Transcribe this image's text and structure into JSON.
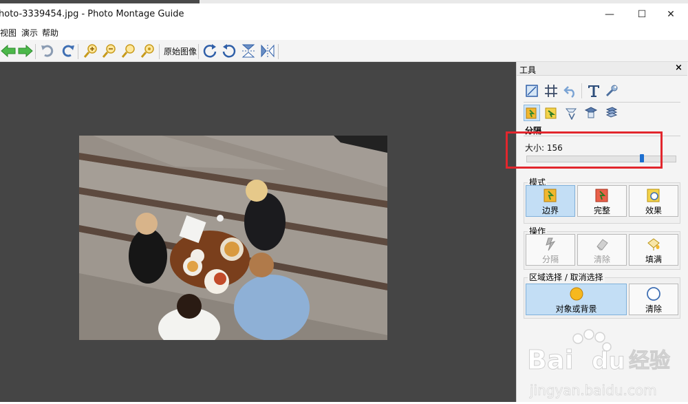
{
  "window": {
    "title": "hoto-3339454.jpg - Photo Montage Guide",
    "controls": {
      "minimize": "—",
      "maximize": "☐",
      "close": "✕"
    }
  },
  "menu": {
    "items": [
      "视图",
      "演示",
      "帮助"
    ]
  },
  "toolbar": {
    "buttons": [
      "back-icon",
      "forward-icon",
      "undo-icon",
      "redo-icon",
      "zoom-in-icon",
      "zoom-out-icon",
      "zoom-fit-icon",
      "zoom-actual-icon",
      "rotate-cw-icon",
      "rotate-ccw-icon",
      "flip-vertical-icon",
      "flip-horizontal-icon"
    ],
    "original_image_label": "原始图像"
  },
  "panel": {
    "title": "工具",
    "close": "×",
    "section_label": "分隔",
    "size_label": "大小: 156",
    "size_fraction": 0.78,
    "mode": {
      "title": "模式",
      "buttons": [
        {
          "label": "边界",
          "icon": "border-icon",
          "state": "active"
        },
        {
          "label": "完整",
          "icon": "complete-icon",
          "state": "normal"
        },
        {
          "label": "效果",
          "icon": "effect-icon",
          "state": "normal"
        }
      ]
    },
    "operation": {
      "title": "操作",
      "buttons": [
        {
          "label": "分隔",
          "icon": "separate-icon",
          "state": "disabled"
        },
        {
          "label": "清除",
          "icon": "eraser-icon",
          "state": "disabled"
        },
        {
          "label": "填满",
          "icon": "fill-icon",
          "state": "normal"
        }
      ]
    },
    "region": {
      "title": "区域选择 / 取消选择",
      "buttons": [
        {
          "label": "对象或背景",
          "icon": "object-circle-icon",
          "state": "active"
        },
        {
          "label": "清除",
          "icon": "clear-circle-icon",
          "state": "normal"
        }
      ]
    }
  },
  "watermark": {
    "brand": "Bai du 经验",
    "url": "jingyan.baidu.com"
  },
  "colors": {
    "canvas": "#454545",
    "highlight": "#e2262d",
    "accent": "#1d6fd0"
  }
}
